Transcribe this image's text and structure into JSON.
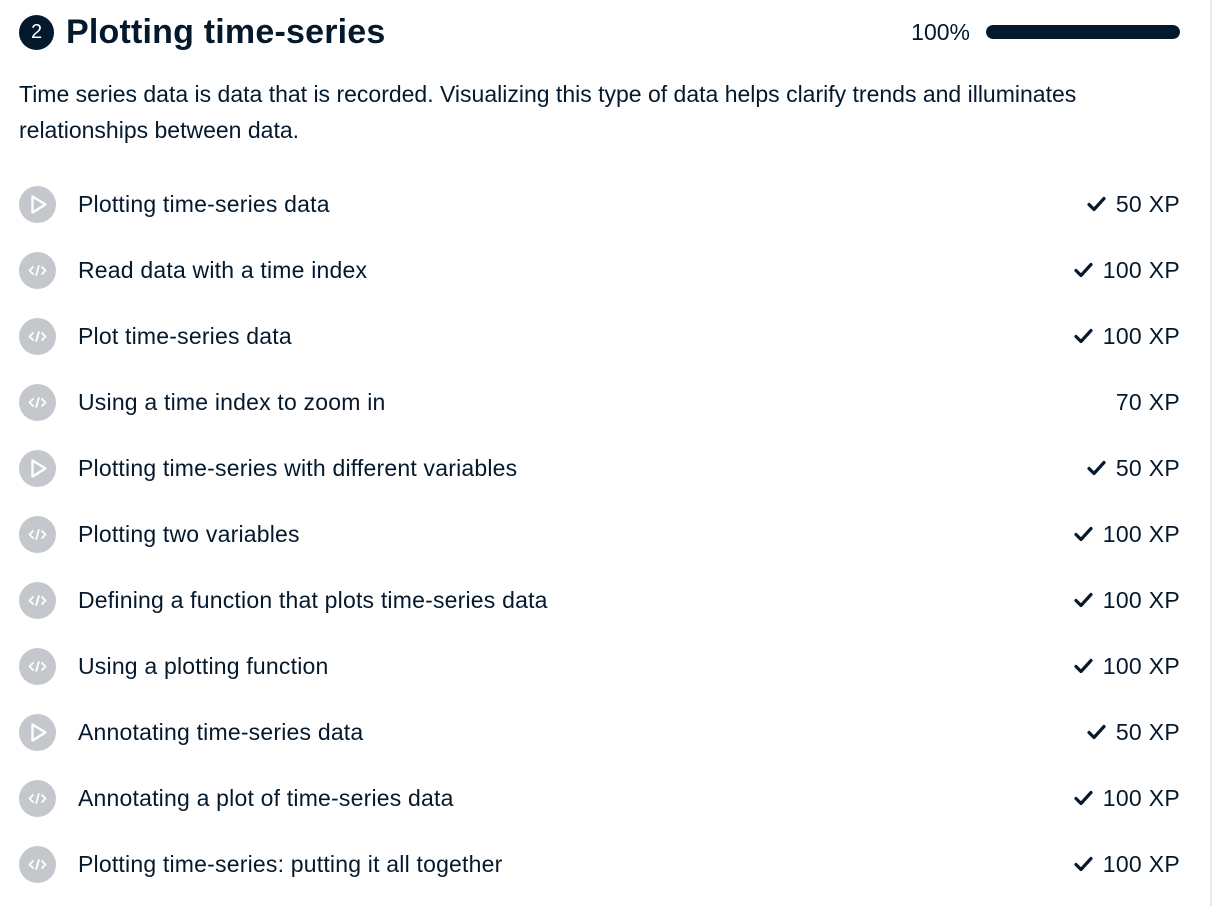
{
  "chapter": {
    "number": "2",
    "title": "Plotting time-series",
    "progress_label": "100%",
    "progress_fraction": 1.0,
    "description": "Time series data is data that is recorded. Visualizing this type of data helps clarify trends and illuminates relationships between data."
  },
  "colors": {
    "ink": "#05192d",
    "icon_bg": "#c4c7cc",
    "track": "#e6e8ec"
  },
  "exercises": [
    {
      "title": "Plotting time-series data",
      "xp": "50 XP",
      "type": "video",
      "icon": "play-icon",
      "completed": true
    },
    {
      "title": "Read data with a time index",
      "xp": "100 XP",
      "type": "code",
      "icon": "code-icon",
      "completed": true
    },
    {
      "title": "Plot time-series data",
      "xp": "100 XP",
      "type": "code",
      "icon": "code-icon",
      "completed": true
    },
    {
      "title": "Using a time index to zoom in",
      "xp": "70 XP",
      "type": "code",
      "icon": "code-icon",
      "completed": false
    },
    {
      "title": "Plotting time-series with different variables",
      "xp": "50 XP",
      "type": "video",
      "icon": "play-icon",
      "completed": true
    },
    {
      "title": "Plotting two variables",
      "xp": "100 XP",
      "type": "code",
      "icon": "code-icon",
      "completed": true
    },
    {
      "title": "Defining a function that plots time-series data",
      "xp": "100 XP",
      "type": "code",
      "icon": "code-icon",
      "completed": true
    },
    {
      "title": "Using a plotting function",
      "xp": "100 XP",
      "type": "code",
      "icon": "code-icon",
      "completed": true
    },
    {
      "title": "Annotating time-series data",
      "xp": "50 XP",
      "type": "video",
      "icon": "play-icon",
      "completed": true
    },
    {
      "title": "Annotating a plot of time-series data",
      "xp": "100 XP",
      "type": "code",
      "icon": "code-icon",
      "completed": true
    },
    {
      "title": "Plotting time-series: putting it all together",
      "xp": "100 XP",
      "type": "code",
      "icon": "code-icon",
      "completed": true
    }
  ]
}
